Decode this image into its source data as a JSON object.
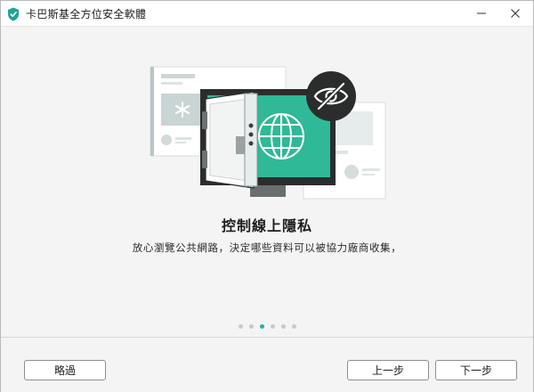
{
  "window": {
    "title": "卡巴斯基全方位安全軟體",
    "minimize_symbol": "—",
    "close_symbol": "✕"
  },
  "main": {
    "heading": "控制線上隱私",
    "description": "放心瀏覽公共網路，決定哪些資料可以被協力廠商收集，"
  },
  "pagination": {
    "total": 6,
    "active_index": 2
  },
  "footer": {
    "skip_label": "略過",
    "prev_label": "上一步",
    "next_label": "下一步"
  },
  "colors": {
    "accent": "#22b3a5",
    "illustration_green": "#2fb996",
    "dark": "#2b2b2b",
    "grey_panel": "#e9eeee"
  },
  "icons": {
    "app": "kaspersky-shield-icon",
    "hidden_eye": "eye-slash-icon",
    "globe": "globe-icon",
    "asterisk": "asterisk-icon"
  }
}
